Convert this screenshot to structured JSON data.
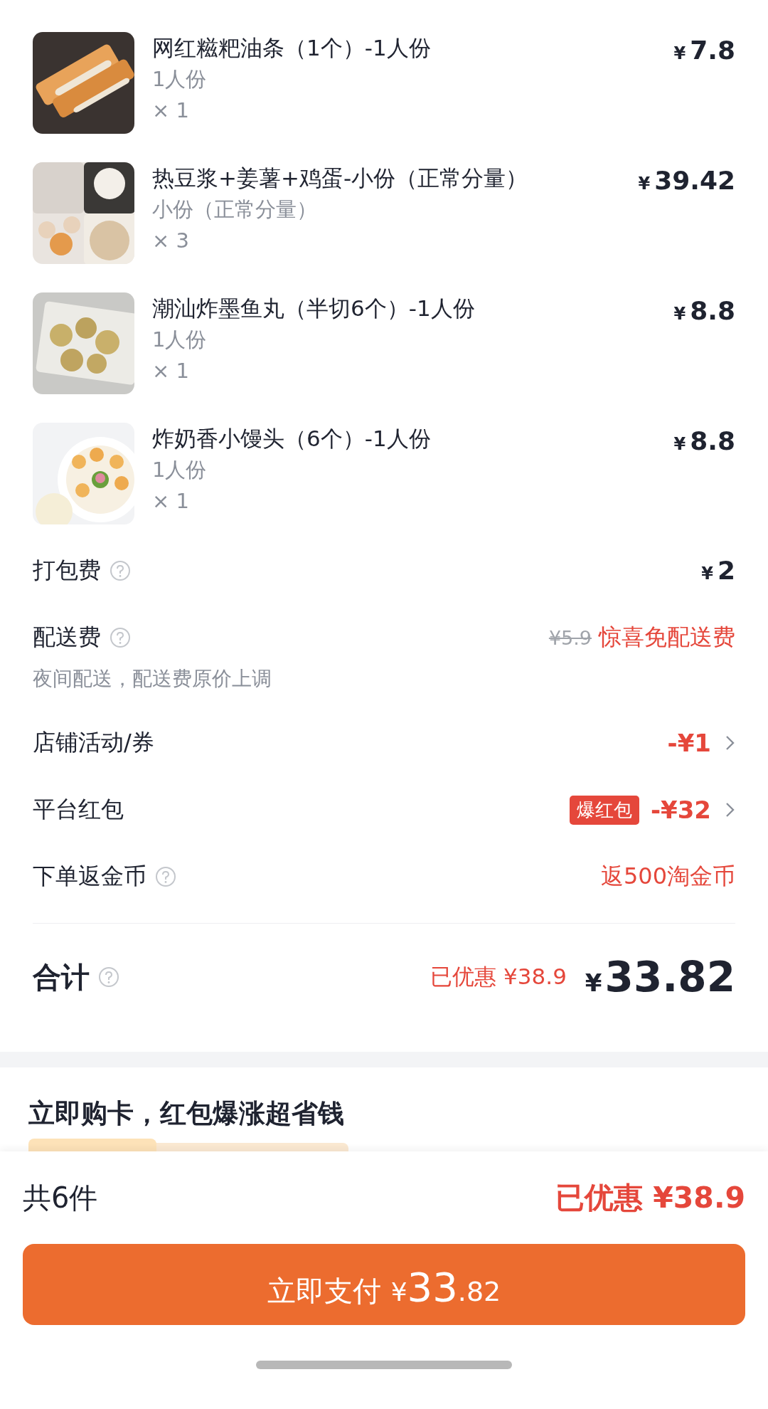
{
  "items": [
    {
      "name": "网红糍粑油条（1个）-1人份",
      "spec": "1人份",
      "qty": "× 1",
      "price": {
        "currency": "¥",
        "amount": "7.8"
      }
    },
    {
      "name": "热豆浆+姜薯+鸡蛋-小份（正常分量）",
      "spec": "小份（正常分量）",
      "qty": "× 3",
      "price": {
        "currency": "¥",
        "amount": "39.42"
      }
    },
    {
      "name": "潮汕炸墨鱼丸（半切6个）-1人份",
      "spec": "1人份",
      "qty": "× 1",
      "price": {
        "currency": "¥",
        "amount": "8.8"
      }
    },
    {
      "name": "炸奶香小馒头（6个）-1人份",
      "spec": "1人份",
      "qty": "× 1",
      "price": {
        "currency": "¥",
        "amount": "8.8"
      }
    }
  ],
  "fees": [
    {
      "kind": "amount",
      "label": "打包费",
      "help": true,
      "currency": "¥",
      "amount": "2"
    },
    {
      "kind": "waived",
      "label": "配送费",
      "help": true,
      "original": "¥5.9",
      "value": "惊喜免配送费",
      "note": "夜间配送，配送费原价上调"
    },
    {
      "kind": "discount",
      "label": "店铺活动/券",
      "help": false,
      "value": "-¥1"
    },
    {
      "kind": "discount",
      "label": "平台红包",
      "help": false,
      "badge": "爆红包",
      "value": "-¥32"
    },
    {
      "kind": "reward",
      "label": "下单返金币",
      "help": true,
      "value": "返500淘金币"
    }
  ],
  "total": {
    "label": "合计",
    "help": true,
    "saved": "已优惠 ¥38.9",
    "currency": "¥",
    "amount": "33.82"
  },
  "promo": {
    "title": "立即购卡，红包爆涨超省钱"
  },
  "footer": {
    "count": "共6件",
    "saved": "已优惠 ¥38.9",
    "pay_button": {
      "label": "立即支付",
      "currency": "¥",
      "major": "33",
      "minor": ".82"
    }
  }
}
